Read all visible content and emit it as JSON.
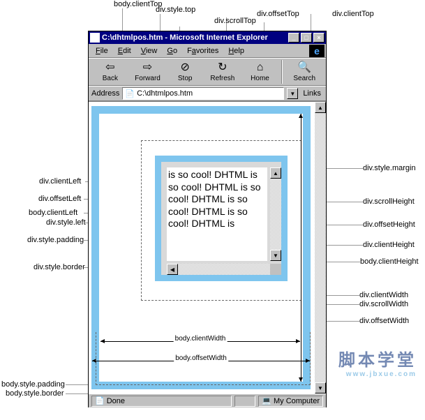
{
  "window": {
    "title": "C:\\dhtmlpos.htm - Microsoft Internet Explorer",
    "minimize": "_",
    "maximize": "□",
    "close": "×"
  },
  "menu": {
    "file": "File",
    "edit": "Edit",
    "view": "View",
    "go": "Go",
    "favorites": "Favorites",
    "help": "Help",
    "ie": "e"
  },
  "toolbar": {
    "back": "Back",
    "forward": "Forward",
    "stop": "Stop",
    "refresh": "Refresh",
    "home": "Home",
    "search": "Search",
    "back_icon": "⇦",
    "forward_icon": "⇨",
    "stop_icon": "⊘",
    "refresh_icon": "↻",
    "home_icon": "⌂",
    "search_icon": "🔍"
  },
  "addressbar": {
    "label": "Address",
    "value": "C:\\dhtmlpos.htm",
    "icon": "📄",
    "dropdown": "▼",
    "links": "Links"
  },
  "div_content": {
    "text": "is so cool! DHTML is so cool! DHTML is so cool! DHTML is so cool! DHTML is so cool! DHTML is"
  },
  "statusbar": {
    "done_icon": "📄",
    "done": "Done",
    "zone_icon": "💻",
    "zone": "My Computer"
  },
  "scrollbar": {
    "up": "▲",
    "down": "▼",
    "left": "◀",
    "right": "▶"
  },
  "labels": {
    "body_clientTop": "body.clientTop",
    "div_style_top": "div.style.top",
    "div_scrollTop": "div.scrollTop",
    "div_offsetTop": "div.offsetTop",
    "div_clientTop": "div.clientTop",
    "div_clientLeft": "div.clientLeft",
    "div_offsetLeft": "div.offsetLeft",
    "body_clientLeft": "body.clientLeft",
    "div_style_left": "div.style.left",
    "div_style_padding": "div.style.padding",
    "div_style_border": "div.style.border",
    "body_style_padding": "body.style.padding",
    "body_style_border": "body.style.border",
    "div_style_margin": "div.style.margin",
    "div_scrollHeight": "div.scrollHeight",
    "div_offsetHeight": "div.offsetHeight",
    "div_clientHeight": "div.clientHeight",
    "body_clientHeight": "body.clientHeight",
    "div_clientWidth": "div.clientWidth",
    "div_scrollWidth": "div.scrollWidth",
    "div_offsetWidth": "div.offsetWidth",
    "body_clientWidth": "body.clientWidth",
    "body_offsetWidth": "body.offsetWidth"
  },
  "watermark": {
    "main": "脚本学堂",
    "sub": "www.jbxue.com"
  }
}
